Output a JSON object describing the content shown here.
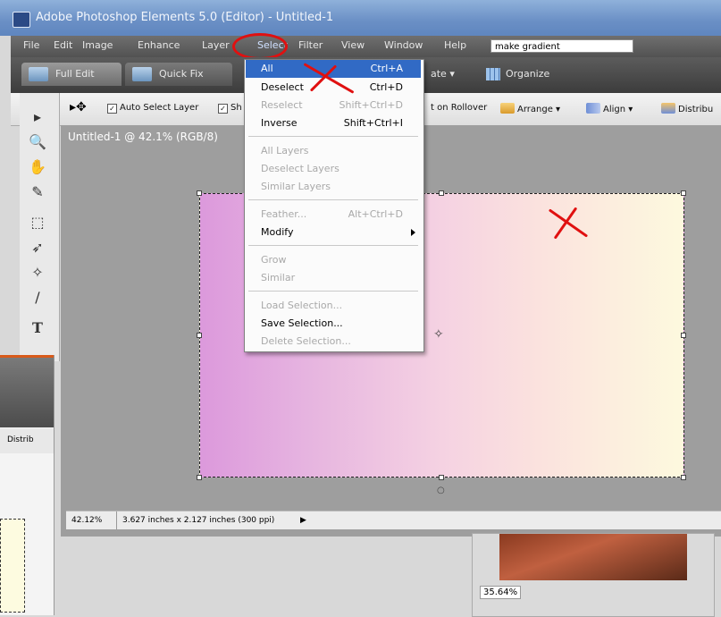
{
  "window": {
    "title": "Adobe Photoshop Elements 5.0 (Editor) - Untitled-1"
  },
  "menu": {
    "items": [
      "File",
      "Edit",
      "Image",
      "Enhance",
      "Layer",
      "Select",
      "Filter",
      "View",
      "Window",
      "Help"
    ],
    "search_value": "make gradient"
  },
  "modes": {
    "full_edit": "Full Edit",
    "quick_fix": "Quick Fix",
    "create": "ate ▾",
    "organize": "Organize"
  },
  "options": {
    "auto_select": "Auto Select Layer",
    "show": "Sh",
    "rollover": "t on Rollover",
    "arrange": "Arrange ▾",
    "align": "Align ▾",
    "distribute": "Distribu"
  },
  "document": {
    "title": "Untitled-1 @ 42.1% (RGB/8)",
    "zoom": "42.12%",
    "info": "3.627 inches x 2.127 inches (300 ppi)"
  },
  "select_menu": {
    "items": [
      {
        "label": "All",
        "shortcut": "Ctrl+A",
        "state": "highlighted"
      },
      {
        "label": "Deselect",
        "shortcut": "Ctrl+D",
        "state": "enabled"
      },
      {
        "label": "Reselect",
        "shortcut": "Shift+Ctrl+D",
        "state": "disabled"
      },
      {
        "label": "Inverse",
        "shortcut": "Shift+Ctrl+I",
        "state": "enabled"
      },
      {
        "label": "All Layers",
        "shortcut": "",
        "state": "disabled"
      },
      {
        "label": "Deselect Layers",
        "shortcut": "",
        "state": "disabled"
      },
      {
        "label": "Similar Layers",
        "shortcut": "",
        "state": "disabled"
      },
      {
        "label": "Feather...",
        "shortcut": "Alt+Ctrl+D",
        "state": "disabled"
      },
      {
        "label": "Modify",
        "shortcut": "",
        "state": "enabled"
      },
      {
        "label": "Grow",
        "shortcut": "",
        "state": "disabled"
      },
      {
        "label": "Similar",
        "shortcut": "",
        "state": "disabled"
      },
      {
        "label": "Load Selection...",
        "shortcut": "",
        "state": "disabled"
      },
      {
        "label": "Save Selection...",
        "shortcut": "",
        "state": "enabled"
      },
      {
        "label": "Delete Selection...",
        "shortcut": "",
        "state": "disabled"
      }
    ]
  },
  "background_window": {
    "distribute": "Distrib"
  },
  "navigator": {
    "zoom": "35.64%"
  },
  "colors": {
    "accent": "#316ac5",
    "annotation_red": "#e01010",
    "gradient_left": "#dc99dc",
    "gradient_right": "#fdf9de"
  }
}
